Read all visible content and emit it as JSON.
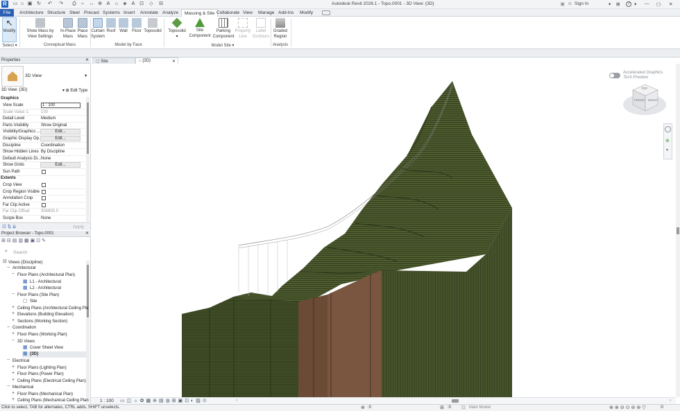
{
  "app": {
    "title": "Autodesk Revit 2026.1 - Topo.0001 - 3D View: {3D}",
    "sign_in": "Sign In",
    "help": "?"
  },
  "menu": [
    "File",
    "Architecture",
    "Structure",
    "Steel",
    "Precast",
    "Systems",
    "Insert",
    "Annotate",
    "Analyze",
    "Massing & Site",
    "Collaborate",
    "View",
    "Manage",
    "Add-Ins",
    "Modify"
  ],
  "ribbon": {
    "modify": "Modify",
    "select": "Select",
    "show_mass": "Show Mass by View Settings",
    "inplace_mass": "In-Place Mass",
    "place_mass": "Place Mass",
    "curtain_system": "Curtain System",
    "roof": "Roof",
    "wall": "Wall",
    "floor": "Floor",
    "toposolid": "Toposolid",
    "toposolid2": "Toposolid",
    "site_component": "Site Component",
    "parking_component": "Parking Component",
    "property_line": "Property Line",
    "label_contours": "Label Contours",
    "graded_region": "Graded Region",
    "groups": {
      "conceptual_mass": "Conceptual Mass",
      "model_by_face": "Model by Face",
      "model_site": "Model Site",
      "analysis": "Analysis"
    }
  },
  "view_tabs": [
    {
      "label": "Site"
    },
    {
      "label": "{3D}"
    }
  ],
  "properties": {
    "title": "Properties",
    "type_name": "3D View",
    "selector": "3D View: {3D}",
    "edit_type": "Edit Type",
    "apply": "Apply",
    "sections": {
      "graphics": "Graphics",
      "extents": "Extents"
    },
    "rows": [
      {
        "k": "View Scale",
        "v": "1 : 100"
      },
      {
        "k": "Scale Value 1:",
        "v": "100"
      },
      {
        "k": "Detail Level",
        "v": "Medium"
      },
      {
        "k": "Parts Visibility",
        "v": "Show Original"
      },
      {
        "k": "Visibility/Graphics ...",
        "v": "Edit..."
      },
      {
        "k": "Graphic Display Op...",
        "v": "Edit..."
      },
      {
        "k": "Discipline",
        "v": "Coordination"
      },
      {
        "k": "Show Hidden Lines",
        "v": "By Discipline"
      },
      {
        "k": "Default Analysis Di...",
        "v": "None"
      },
      {
        "k": "Show Grids",
        "v": "Edit..."
      },
      {
        "k": "Sun Path",
        "v": ""
      },
      {
        "k": "Crop View",
        "v": ""
      },
      {
        "k": "Crop Region Visible",
        "v": ""
      },
      {
        "k": "Annotation Crop",
        "v": ""
      },
      {
        "k": "Far Clip Active",
        "v": ""
      },
      {
        "k": "Far Clip Offset",
        "v": "304800.0"
      },
      {
        "k": "Scope Box",
        "v": "None"
      }
    ]
  },
  "browser": {
    "title": "Project Browser - Topo.0001",
    "search_placeholder": "Search",
    "items": [
      "Views (Discipline)",
      "Architectural",
      "Floor Plans (Architectural Plan)",
      "L1 - Architectural",
      "L2 - Architectural",
      "Floor Plans (Site Plan)",
      "Site",
      "Ceiling Plans (Architectural Ceiling Pla",
      "Elevations (Building Elevation)",
      "Sections (Working Section)",
      "Coordination",
      "Floor Plans (Working Plan)",
      "3D Views",
      "Cover Sheet View",
      "{3D}",
      "Electrical",
      "Floor Plans (Lighting Plan)",
      "Floor Plans (Power Plan)",
      "Ceiling Plans (Electrical Ceiling Plan)",
      "Mechanical",
      "Floor Plans (Mechanical Plan)",
      "Ceiling Plans (Mechanical Ceiling Plan"
    ]
  },
  "view": {
    "accel_title": "Accelerated Graphics",
    "accel_sub": "Tech Preview",
    "scale": "1 : 100",
    "viewcube": {
      "top": "TOP",
      "front": "FRONT",
      "right": "RIGHT"
    }
  },
  "status": {
    "hint": "Click to select, TAB for alternates, CTRL adds, SHIFT unselects.",
    "model": "Main Model",
    "zero": ":0"
  },
  "colors": {
    "terrain": "#4c5a2c",
    "soil": "#6b4a36",
    "ribbon_blue": "#2a5fb3"
  }
}
